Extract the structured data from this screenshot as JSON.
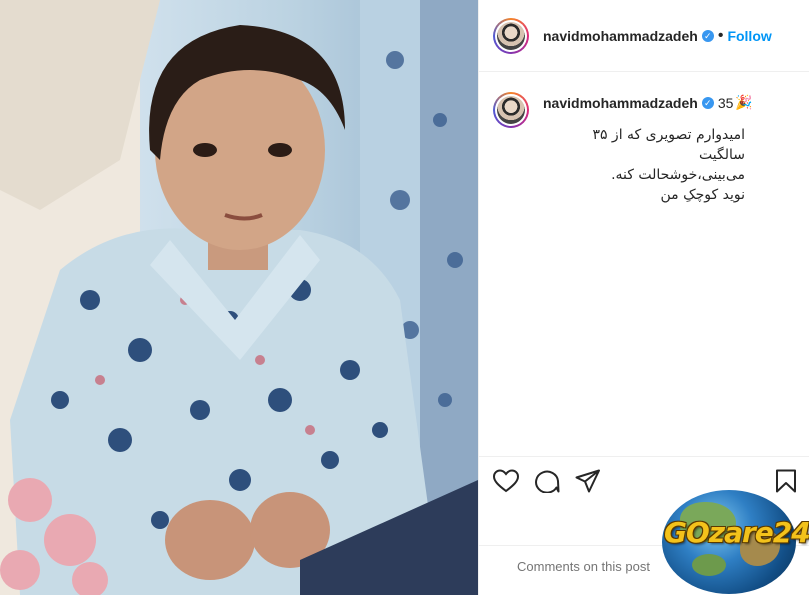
{
  "post": {
    "username": "navidmohammadzadeh",
    "verified_icon": "verified-badge-icon",
    "separator": "•",
    "follow_label": "Follow"
  },
  "caption": {
    "username": "navidmohammadzadeh",
    "count": "35",
    "emoji": "🎉",
    "lines": [
      "امیدوارم تصویری که از ۳۵ سالگیت",
      "می‌بینی،خوشحالت کنه.",
      "نوید کوچکِ من"
    ]
  },
  "actions": {
    "like_icon": "heart-icon",
    "comment_icon": "comment-icon",
    "share_icon": "share-icon",
    "save_icon": "bookmark-icon"
  },
  "comment_bar": {
    "placeholder": "Comments on this post"
  },
  "watermark": {
    "text": "GOzare24"
  },
  "colors": {
    "link_blue": "#0095f6",
    "verified_blue": "#3897f0",
    "watermark_gold": "#f3c21b"
  }
}
